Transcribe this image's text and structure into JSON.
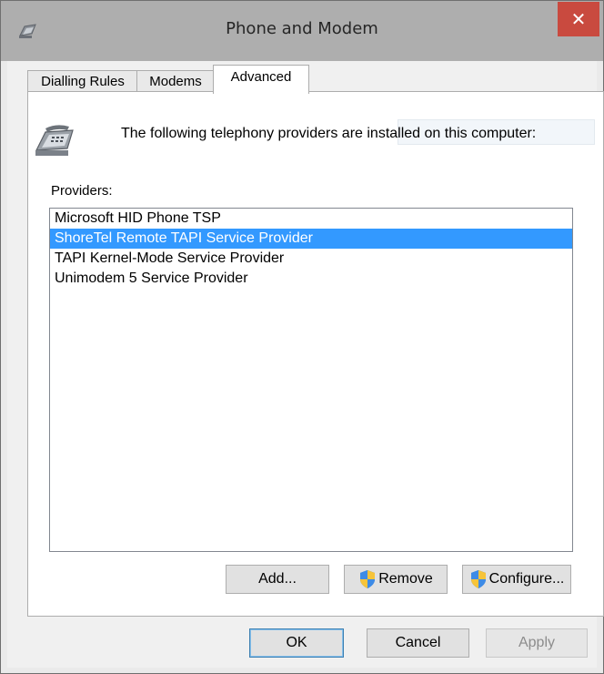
{
  "window": {
    "title": "Phone and Modem",
    "close_glyph": "✕",
    "close_color": "#c94a3f",
    "title_icon": "phone-modem-icon"
  },
  "tabs": [
    {
      "label": "Dialling Rules",
      "active": false
    },
    {
      "label": "Modems",
      "active": false
    },
    {
      "label": "Advanced",
      "active": true
    }
  ],
  "advanced": {
    "intro_icon": "telephone-icon",
    "intro_text": "The following telephony providers are installed on this computer:",
    "providers_label": "Providers:",
    "providers": [
      {
        "label": "Microsoft HID Phone TSP",
        "selected": false
      },
      {
        "label": "ShoreTel Remote TAPI Service Provider",
        "selected": true
      },
      {
        "label": "TAPI Kernel-Mode Service Provider",
        "selected": false
      },
      {
        "label": "Unimodem 5 Service Provider",
        "selected": false
      }
    ],
    "selection_color": "#3399ff",
    "buttons": {
      "add": "Add...",
      "remove": "Remove",
      "configure": "Configure...",
      "shield_icon": "uac-shield-icon"
    }
  },
  "footer": {
    "ok": "OK",
    "cancel": "Cancel",
    "apply": "Apply",
    "apply_enabled": false
  }
}
